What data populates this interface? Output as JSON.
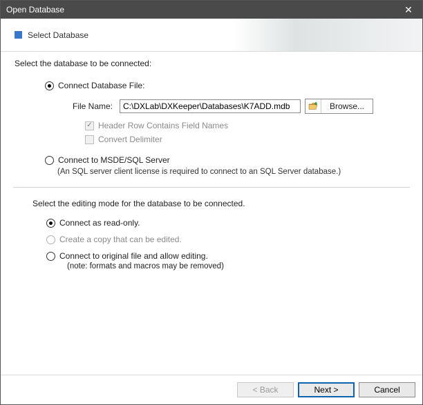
{
  "window": {
    "title": "Open Database"
  },
  "banner": {
    "title": "Select Database"
  },
  "section1": {
    "prompt": "Select the database to be connected:",
    "opt_file": {
      "label": "Connect Database File:",
      "file_label": "File Name:",
      "file_value": "C:\\DXLab\\DXKeeper\\Databases\\K7ADD.mdb",
      "browse": "Browse...",
      "header_row": "Header Row Contains Field Names",
      "convert_delim": "Convert Delimiter"
    },
    "opt_sql": {
      "label": "Connect to MSDE/SQL Server",
      "note": "(An SQL server client license is required to connect to an SQL Server database.)"
    }
  },
  "section2": {
    "prompt": "Select the editing mode for the database to be connected.",
    "readonly": "Connect as read-only.",
    "copy": "Create a copy that can be edited.",
    "original": "Connect to original file and allow editing.",
    "original_note": "(note:  formats and macros may be removed)"
  },
  "footer": {
    "back": "< Back",
    "next": "Next >",
    "cancel": "Cancel"
  }
}
